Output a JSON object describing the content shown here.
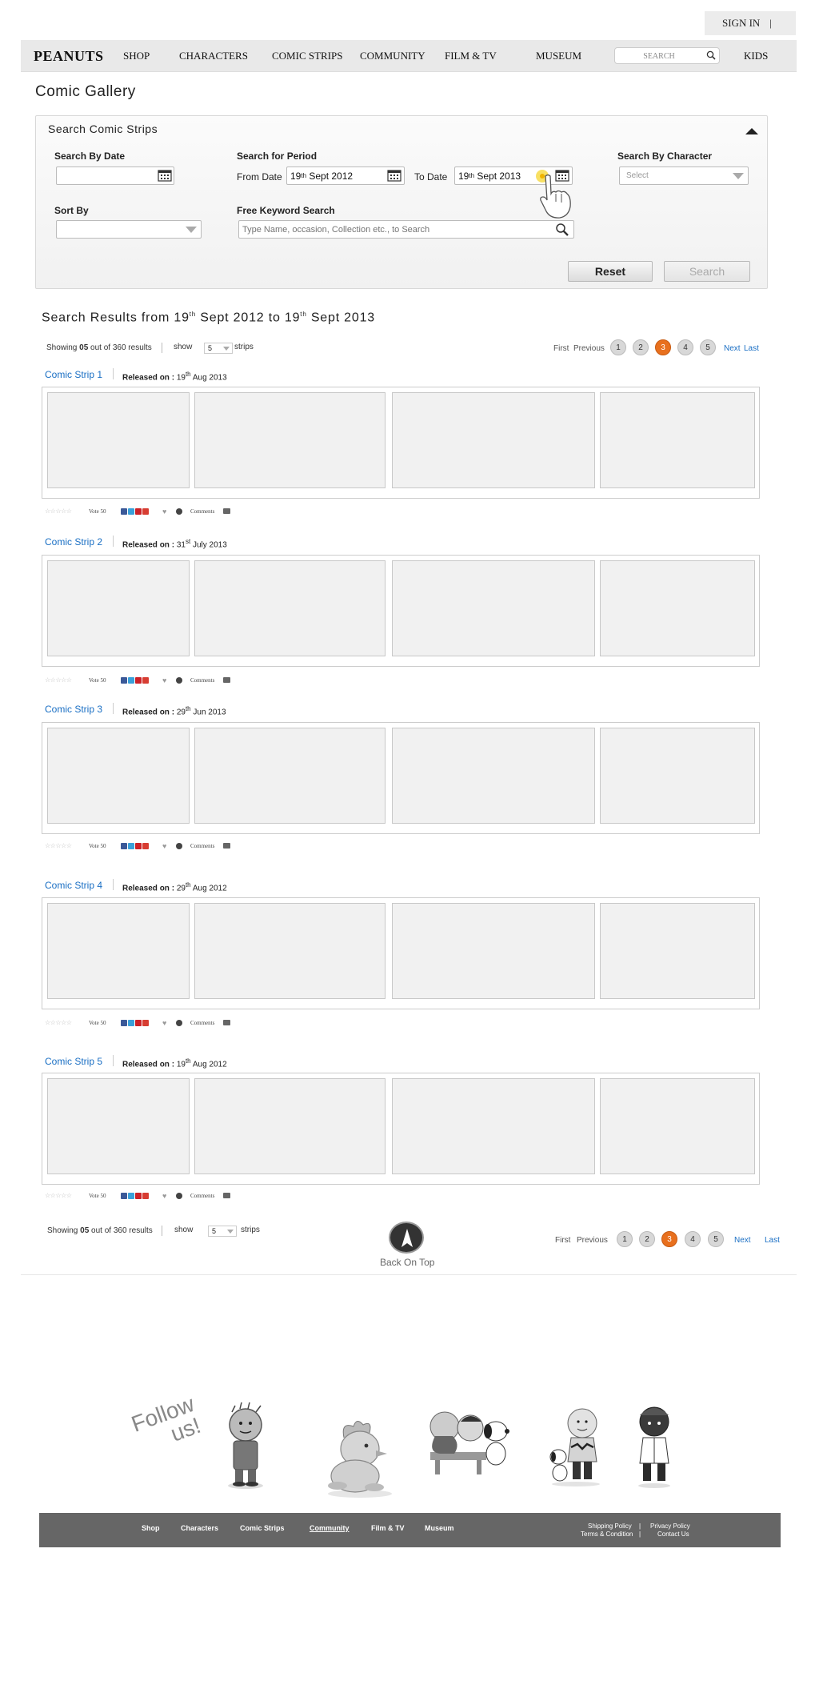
{
  "header": {
    "signin_label": "SIGN IN",
    "signin_sep": "|",
    "logo": "PEANUTS",
    "nav": [
      "SHOP",
      "CHARACTERS",
      "COMIC STRIPS",
      "COMMUNITY",
      "FILM & TV",
      "MUSEUM"
    ],
    "search_placeholder": "SEARCH",
    "kids_label": "KIDS"
  },
  "page_title": "Comic Gallery",
  "search_panel": {
    "title": "Search Comic Strips",
    "by_date_label": "Search By Date",
    "period_label": "Search for Period",
    "from_label": "From Date",
    "from_day": "19",
    "from_suffix": "th",
    "from_rest": " Sept 2012",
    "to_label": "To Date",
    "to_day": "19",
    "to_suffix": "th",
    "to_rest": " Sept 2013",
    "character_label": "Search By Character",
    "character_value": "Select",
    "sort_label": "Sort By",
    "keyword_label": "Free Keyword Search",
    "keyword_placeholder": "Type Name, occasion, Collection etc., to Search",
    "reset_label": "Reset",
    "search_label": "Search"
  },
  "results": {
    "title_a": "Search Results from 19",
    "title_sup1": "th",
    "title_b": " Sept 2012 to 19",
    "title_sup2": "th",
    "title_c": " Sept 2013",
    "showing_pre": "Showing ",
    "showing_count": "05",
    "showing_post": " out of 360 results",
    "show_label": "show",
    "show_value": "5",
    "strips_label": "strips",
    "first_label": "First",
    "previous_label": "Previous",
    "pages": [
      "1",
      "2",
      "3",
      "4",
      "5"
    ],
    "active_page": "3",
    "next_label": "Next",
    "last_label": "Last"
  },
  "strips": [
    {
      "title": "Comic Strip 1",
      "released_label": "Released on :",
      "day": "19",
      "suffix": "th",
      "rest": " Aug 2013",
      "votes": "Vote 50",
      "comments": "Comments"
    },
    {
      "title": "Comic Strip 2",
      "released_label": "Released on :",
      "day": "31",
      "suffix": "st",
      "rest": " July 2013",
      "votes": "Vote 50",
      "comments": "Comments"
    },
    {
      "title": "Comic Strip 3",
      "released_label": "Released on :",
      "day": "29",
      "suffix": "th",
      "rest": " Jun 2013",
      "votes": "Vote 50",
      "comments": "Comments"
    },
    {
      "title": "Comic Strip 4",
      "released_label": "Released on :",
      "day": "29",
      "suffix": "th",
      "rest": " Aug 2012",
      "votes": "Vote 50",
      "comments": "Comments"
    },
    {
      "title": "Comic Strip 5",
      "released_label": "Released on :",
      "day": "19",
      "suffix": "th",
      "rest": " Aug 2012",
      "votes": "Vote 50",
      "comments": "Comments"
    }
  ],
  "back_on_top": "Back On Top",
  "follow_line1": "Follow",
  "follow_line2": "us!",
  "footer": {
    "links": [
      "Shop",
      "Characters",
      "Comic Strips",
      "Community",
      "Film & TV",
      "Museum"
    ],
    "shipping": "Shipping Policy",
    "privacy": "Privacy Policy",
    "terms": "Terms & Condition",
    "contact": "Contact Us",
    "sep": "|"
  },
  "colors": {
    "accent": "#e8701e",
    "link": "#1a6fc4",
    "footer_bg": "#666666"
  }
}
